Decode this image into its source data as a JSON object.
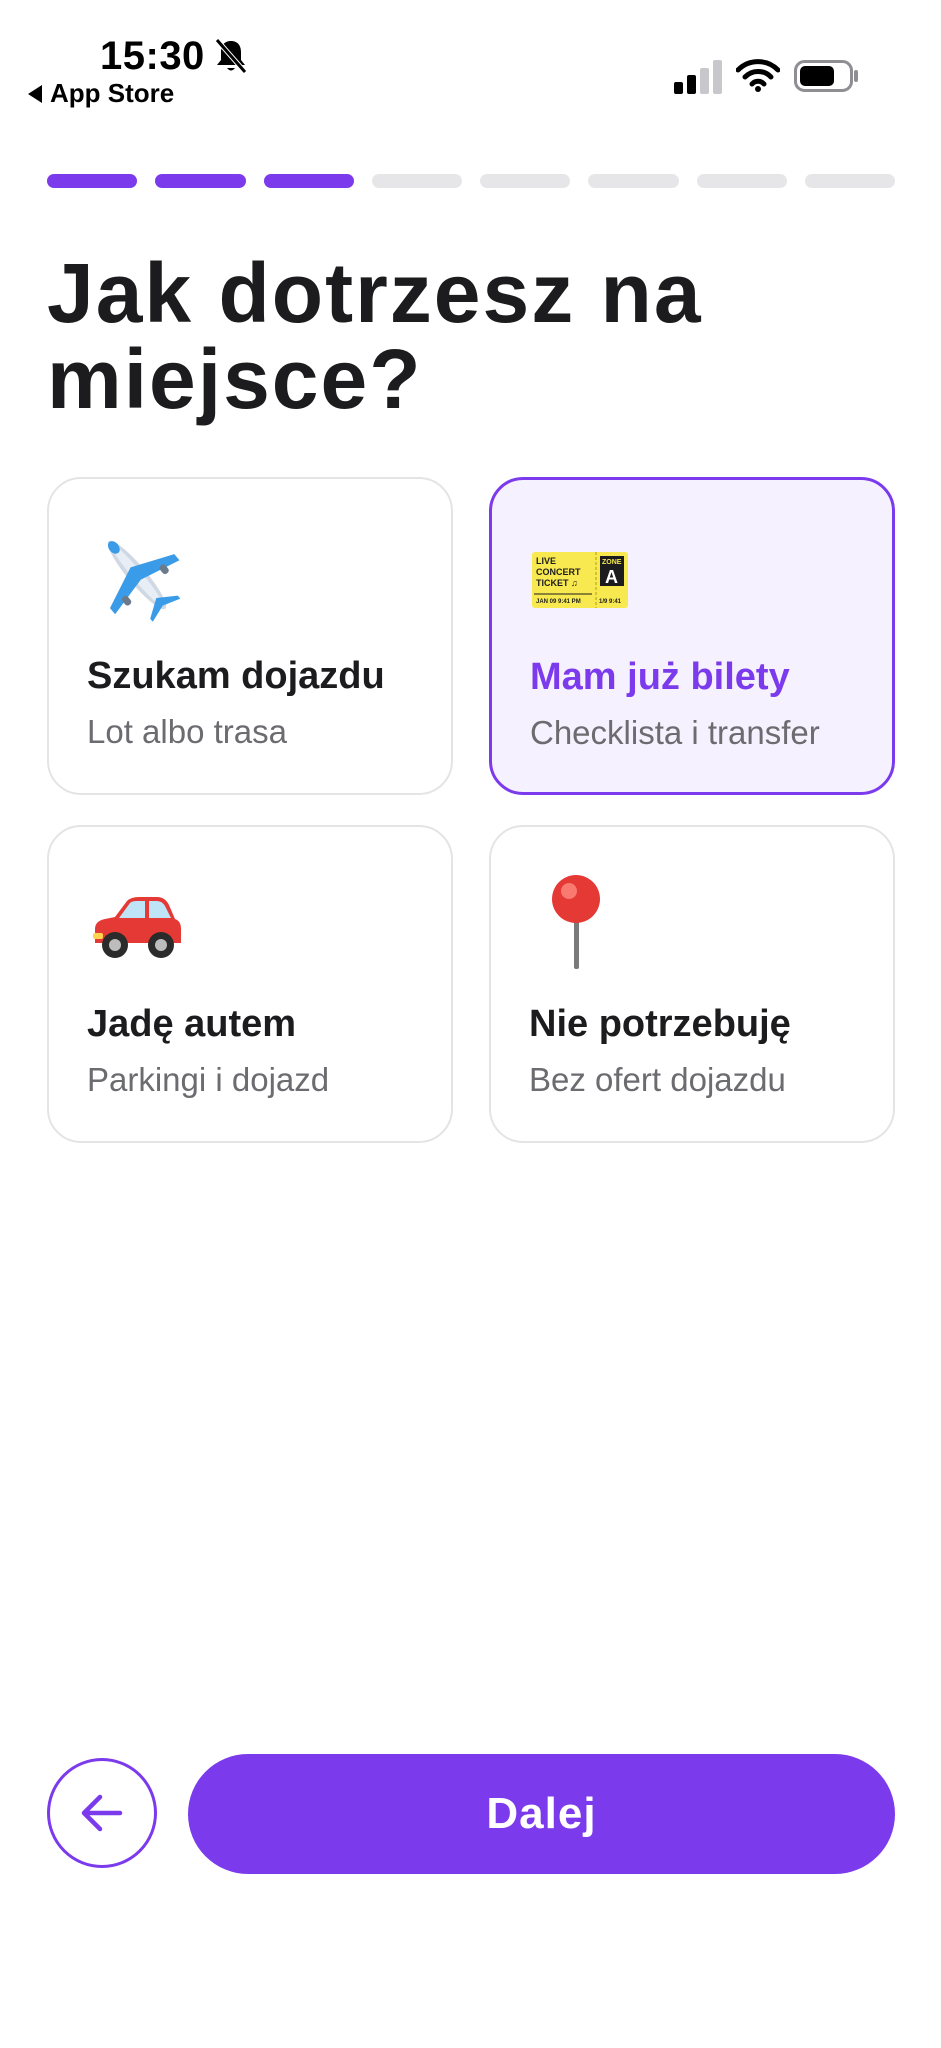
{
  "status_bar": {
    "time": "15:30",
    "back_app_label": "App Store",
    "icons": [
      "bell-off-icon",
      "signal-icon",
      "wifi-icon",
      "battery-icon"
    ]
  },
  "progress": {
    "total_steps": 8,
    "completed_steps": 3
  },
  "title": "Jak dotrzesz na miejsce?",
  "options": [
    {
      "icon": "airplane-icon",
      "label": "Szukam dojazdu",
      "sublabel": "Lot albo trasa",
      "selected": false
    },
    {
      "icon": "ticket-icon",
      "label": "Mam już bilety",
      "sublabel": "Checklista i transfer",
      "selected": true
    },
    {
      "icon": "car-icon",
      "label": "Jadę autem",
      "sublabel": "Parkingi i dojazd",
      "selected": false
    },
    {
      "icon": "pin-icon",
      "label": "Nie potrzebuję",
      "sublabel": "Bez ofert dojazdu",
      "selected": false
    }
  ],
  "ticket_icon_text": {
    "live": "LIVE",
    "concert": "CONCERT",
    "ticket": "TICKET ♫",
    "zone": "ZONE",
    "zone_letter": "A",
    "date_left": "JAN 09 9:41 PM",
    "date_right": "1/9 9:41"
  },
  "actions": {
    "back_icon": "arrow-left-icon",
    "next_label": "Dalej"
  },
  "colors": {
    "accent": "#7c3aed",
    "selected_bg": "#f6f1fe",
    "card_border": "#e4e4e7",
    "progress_inactive": "#e6e6e8",
    "subtext": "#6b6b70"
  }
}
